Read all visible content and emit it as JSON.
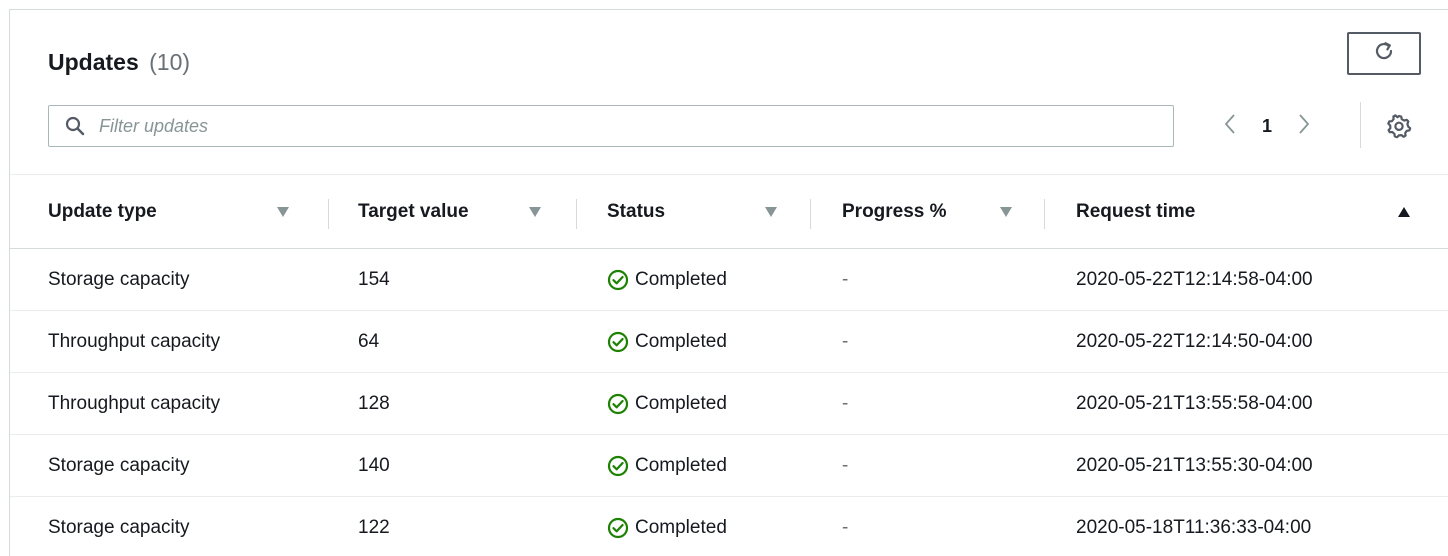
{
  "header": {
    "title": "Updates",
    "count": "(10)"
  },
  "filter": {
    "placeholder": "Filter updates",
    "value": ""
  },
  "pagination": {
    "current_page": "1"
  },
  "table": {
    "columns": [
      {
        "label": "Update type",
        "sort": "none"
      },
      {
        "label": "Target value",
        "sort": "none"
      },
      {
        "label": "Status",
        "sort": "none"
      },
      {
        "label": "Progress %",
        "sort": "none"
      },
      {
        "label": "Request time",
        "sort": "ascending"
      }
    ],
    "rows": [
      {
        "update_type": "Storage capacity",
        "target_value": "154",
        "status": "Completed",
        "progress": "-",
        "request_time": "2020-05-22T12:14:58-04:00"
      },
      {
        "update_type": "Throughput capacity",
        "target_value": "64",
        "status": "Completed",
        "progress": "-",
        "request_time": "2020-05-22T12:14:50-04:00"
      },
      {
        "update_type": "Throughput capacity",
        "target_value": "128",
        "status": "Completed",
        "progress": "-",
        "request_time": "2020-05-21T13:55:58-04:00"
      },
      {
        "update_type": "Storage capacity",
        "target_value": "140",
        "status": "Completed",
        "progress": "-",
        "request_time": "2020-05-21T13:55:30-04:00"
      },
      {
        "update_type": "Storage capacity",
        "target_value": "122",
        "status": "Completed",
        "progress": "-",
        "request_time": "2020-05-18T11:36:33-04:00"
      }
    ]
  },
  "icons": {
    "refresh": "refresh-icon",
    "search": "search-icon",
    "prev": "chevron-left-icon",
    "next": "chevron-right-icon",
    "settings": "gear-icon",
    "sort_desc": "caret-down-icon",
    "sort_asc": "caret-up-icon",
    "status_ok": "check-circle-icon"
  },
  "colors": {
    "success": "#1d8102",
    "text": "#16191f",
    "muted": "#687078",
    "border": "#d5dbdb",
    "icon": "#545b64"
  }
}
